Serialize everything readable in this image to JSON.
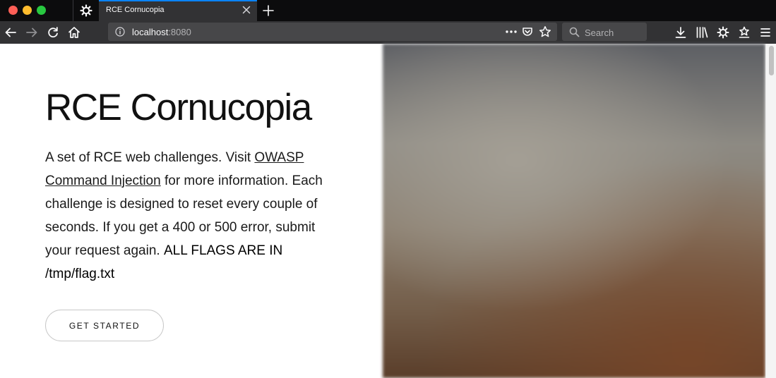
{
  "browser": {
    "tab_title": "RCE Cornucopia",
    "url_host": "localhost",
    "url_port": ":8080",
    "search_placeholder": "Search"
  },
  "page": {
    "title": "RCE Cornucopia",
    "desc_intro": "A set of RCE web challenges. Visit ",
    "desc_link": "OWASP Command Injection",
    "desc_middle": " for more information. Each challenge is designed to reset every couple of seconds. If you get a 400 or 500 error, submit your request again. ",
    "desc_emphasis": "ALL FLAGS ARE IN /tmp/flag.txt",
    "cta_label": "GET STARTED"
  },
  "colors": {
    "accent_tab": "#0a84ff",
    "chrome_dark": "#0c0c0d",
    "toolbar": "#323234"
  },
  "icons": {
    "pinned_tab": "gear-icon",
    "nav": [
      "back-icon",
      "forward-icon",
      "reload-icon",
      "home-icon"
    ],
    "url_actions": [
      "info-icon",
      "more-icon",
      "pocket-icon",
      "bookmark-star-icon"
    ],
    "toolbar": [
      "download-icon",
      "library-icon",
      "gear-icon",
      "sync-icon",
      "menu-icon"
    ]
  }
}
